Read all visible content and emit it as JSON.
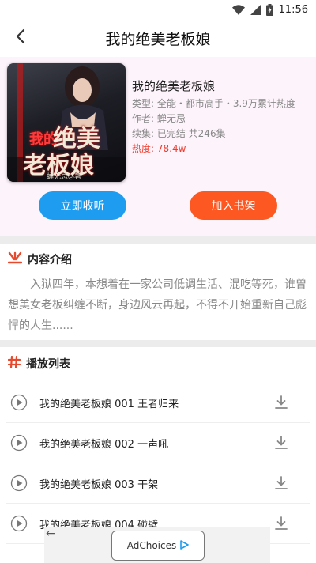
{
  "status_bar": {
    "time": "11:56"
  },
  "header": {
    "title": "我的绝美老板娘",
    "back_icon": "chevron-left-icon"
  },
  "book": {
    "cover_text": {
      "line_a": "我的",
      "line_b": "绝美",
      "line_c": "老板娘",
      "author": "蝉无忌◎著"
    },
    "title": "我的绝美老板娘",
    "type_line": "类型: 全能・都市高手・3.9万累计热度",
    "author_line": "作者: 蝉无忌",
    "episodes_line": "续集: 已完结 共246集",
    "hot_label": "热度: ",
    "hot_value": "78.4w",
    "collect_label": "立即收听",
    "shelf_label": "加入书架"
  },
  "intro": {
    "title": "内容介绍",
    "text": "入狱四年，本想着在一家公司低调生活、混吃等死，谁曾想美女老板纠缠不断，身边风云再起，不得不开始重新自己彪悍的人生......"
  },
  "playlist": {
    "title": "播放列表",
    "tracks": [
      {
        "name": "我的绝美老板娘 001 王者归来"
      },
      {
        "name": "我的绝美老板娘 002 一声吼"
      },
      {
        "name": "我的绝美老板娘 003 干架"
      },
      {
        "name": "我的绝美老板娘 004 碰壁"
      }
    ]
  },
  "ad": {
    "back": "←",
    "label": "AdChoices"
  },
  "colors": {
    "accent_blue": "#1e9cf0",
    "accent_orange": "#fd5722",
    "hot_red": "#ee3b2d",
    "panel_pink": "#fdf3fb"
  }
}
